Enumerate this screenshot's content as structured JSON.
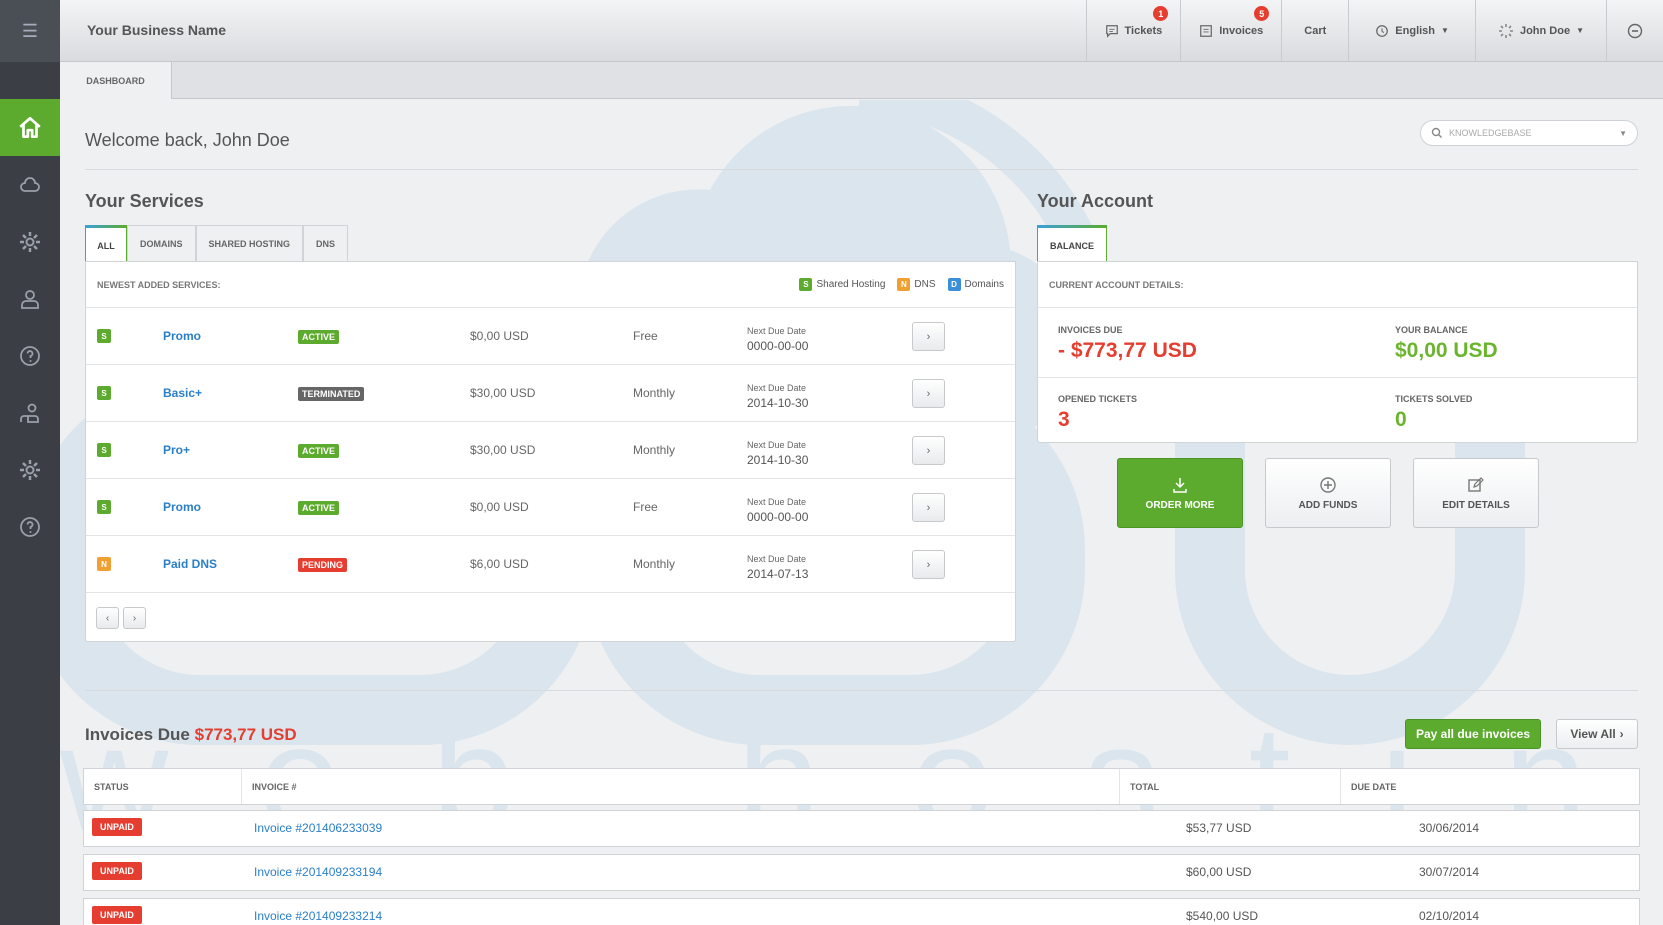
{
  "topbar": {
    "business_name": "Your Business Name",
    "nav": [
      {
        "label": "Tickets",
        "badge": "1",
        "icon": "chat-icon"
      },
      {
        "label": "Invoices",
        "badge": "5",
        "icon": "invoice-icon"
      },
      {
        "label": "Cart",
        "badge": "",
        "icon": ""
      },
      {
        "label": "English",
        "badge": "",
        "icon": "globe-icon"
      },
      {
        "label": "John Doe",
        "badge": "",
        "icon": "spinner-icon"
      }
    ]
  },
  "subbar": {
    "tab": "DASHBOARD"
  },
  "welcome": "Welcome back, John Doe",
  "search": {
    "placeholder": "KNOWLEDGEBASE"
  },
  "services": {
    "title": "Your Services",
    "tabs": [
      "ALL",
      "DOMAINS",
      "SHARED HOSTING",
      "DNS"
    ],
    "head": "NEWEST ADDED SERVICES:",
    "legend": [
      {
        "letter": "S",
        "label": "Shared Hosting"
      },
      {
        "letter": "N",
        "label": "DNS"
      },
      {
        "letter": "D",
        "label": "Domains"
      }
    ],
    "due_label": "Next Due Date",
    "rows": [
      {
        "type": "S",
        "name": "Promo",
        "status": "ACTIVE",
        "price": "$0,00 USD",
        "cycle": "Free",
        "due": "0000-00-00"
      },
      {
        "type": "S",
        "name": "Basic+",
        "status": "TERMINATED",
        "price": "$30,00 USD",
        "cycle": "Monthly",
        "due": "2014-10-30"
      },
      {
        "type": "S",
        "name": "Pro+",
        "status": "ACTIVE",
        "price": "$30,00 USD",
        "cycle": "Monthly",
        "due": "2014-10-30"
      },
      {
        "type": "S",
        "name": "Promo",
        "status": "ACTIVE",
        "price": "$0,00 USD",
        "cycle": "Free",
        "due": "0000-00-00"
      },
      {
        "type": "N",
        "name": "Paid DNS",
        "status": "PENDING",
        "price": "$6,00 USD",
        "cycle": "Monthly",
        "due": "2014-07-13"
      }
    ]
  },
  "account": {
    "title": "Your Account",
    "tab": "BALANCE",
    "head": "CURRENT ACCOUNT DETAILS:",
    "invoices_due_label": "INVOICES DUE",
    "invoices_due_value": "- $773,77 USD",
    "balance_label": "YOUR BALANCE",
    "balance_value": "$0,00 USD",
    "opened_label": "OPENED TICKETS",
    "opened_value": "3",
    "solved_label": "TICKETS SOLVED",
    "solved_value": "0",
    "buttons": {
      "order": "ORDER MORE",
      "funds": "ADD FUNDS",
      "edit": "EDIT DETAILS"
    }
  },
  "invoices": {
    "title": "Invoices Due",
    "amount": "$773,77 USD",
    "pay_all": "Pay all due invoices",
    "view_all": "View All",
    "columns": [
      "STATUS",
      "INVOICE #",
      "TOTAL",
      "DUE DATE"
    ],
    "rows": [
      {
        "status": "UNPAID",
        "number": "Invoice #201406233039",
        "total": "$53,77 USD",
        "due": "30/06/2014"
      },
      {
        "status": "UNPAID",
        "number": "Invoice #201409233194",
        "total": "$60,00 USD",
        "due": "30/07/2014"
      },
      {
        "status": "UNPAID",
        "number": "Invoice #201409233214",
        "total": "$540,00 USD",
        "due": "02/10/2014"
      }
    ]
  },
  "watermark": {
    "text": "web hosting"
  }
}
